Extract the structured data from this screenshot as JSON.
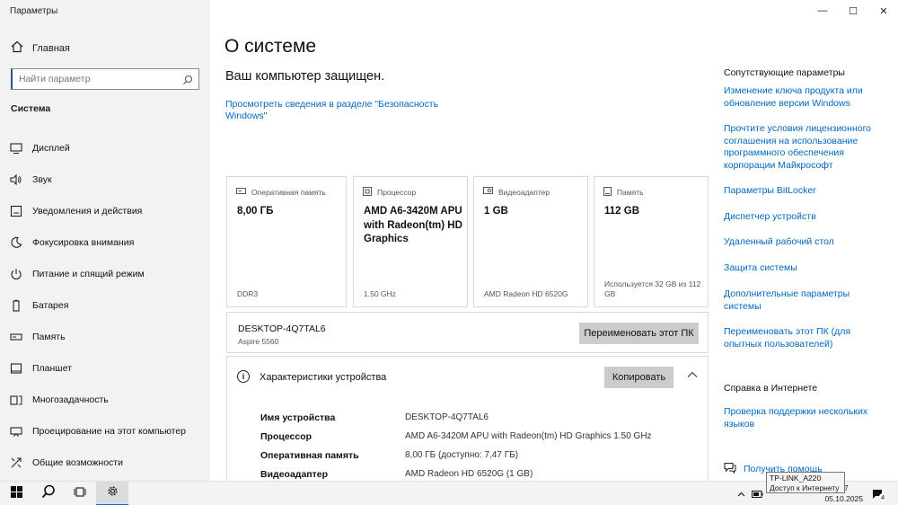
{
  "window": {
    "title": "Параметры",
    "min": "—",
    "max": "☐",
    "close": "✕"
  },
  "nav": {
    "home": "Главная",
    "search_placeholder": "Найти параметр",
    "section": "Система",
    "items": [
      {
        "label": "Дисплей",
        "icon": "monitor-icon"
      },
      {
        "label": "Звук",
        "icon": "speaker-icon"
      },
      {
        "label": "Уведомления и действия",
        "icon": "notifications-icon"
      },
      {
        "label": "Фокусировка внимания",
        "icon": "moon-icon"
      },
      {
        "label": "Питание и спящий режим",
        "icon": "power-icon"
      },
      {
        "label": "Батарея",
        "icon": "battery-icon"
      },
      {
        "label": "Память",
        "icon": "storage-icon"
      },
      {
        "label": "Планшет",
        "icon": "tablet-icon"
      },
      {
        "label": "Многозадачность",
        "icon": "multitask-icon"
      },
      {
        "label": "Проецирование на этот компьютер",
        "icon": "projector-icon"
      },
      {
        "label": "Общие возможности",
        "icon": "share-icon"
      }
    ]
  },
  "main": {
    "title": "О системе",
    "protected": "Ваш компьютер защищен.",
    "security_link": "Просмотреть сведения в разделе \"Безопасность Windows\"",
    "cards": [
      {
        "label": "Оперативная память",
        "value": "8,00 ГБ",
        "sub": "DDR3",
        "icon": "ram-icon"
      },
      {
        "label": "Процессор",
        "value": "AMD A6-3420M APU with Radeon(tm) HD Graphics",
        "sub": "1.50 GHz",
        "icon": "cpu-icon"
      },
      {
        "label": "Видеоадаптер",
        "value": "1 GB",
        "sub": "AMD Radeon HD 6520G",
        "icon": "gpu-icon"
      },
      {
        "label": "Память",
        "value": "112 GB",
        "sub": "Используется 32 GB из 112 GB",
        "icon": "disk-icon"
      }
    ],
    "pc": {
      "name": "DESKTOP-4Q7TAL6",
      "model": "Aspire 5560",
      "rename": "Переименовать этот ПК"
    },
    "specs": {
      "title": "Характеристики устройства",
      "copy": "Копировать",
      "rows": [
        {
          "k": "Имя устройства",
          "v": "DESKTOP-4Q7TAL6"
        },
        {
          "k": "Процессор",
          "v": "AMD A6-3420M APU with Radeon(tm) HD Graphics   1.50 GHz"
        },
        {
          "k": "Оперативная память",
          "v": "8,00 ГБ (доступно: 7,47 ГБ)"
        },
        {
          "k": "Видеоадаптер",
          "v": "AMD Radeon HD 6520G (1 GB)"
        }
      ]
    }
  },
  "related": {
    "heading": "Сопутствующие параметры",
    "links": [
      "Изменение ключа продукта или обновление версии Windows",
      "Прочтите условия лицензионного соглашения на использование программного обеспечения корпорации Майкрософт",
      "Параметры BitLocker",
      "Диспетчер устройств",
      "Удаленный рабочий стол",
      "Защита системы",
      "Дополнительные параметры системы",
      "Переименовать этот ПК (для опытных пользователей)"
    ],
    "help_heading": "Справка в Интернете",
    "help_link": "Проверка поддержки нескольких языков",
    "get_help": "Получить помощь"
  },
  "tooltip": {
    "line1": "TP-LINK_A220",
    "line2": "Доступ к Интернету"
  },
  "taskbar": {
    "date": "05.10.2025",
    "time_partial": "7",
    "notif_count": "4"
  },
  "colors": {
    "accent": "#0078d7",
    "link": "#0067c0",
    "nav_bg": "#f2f2f2"
  }
}
